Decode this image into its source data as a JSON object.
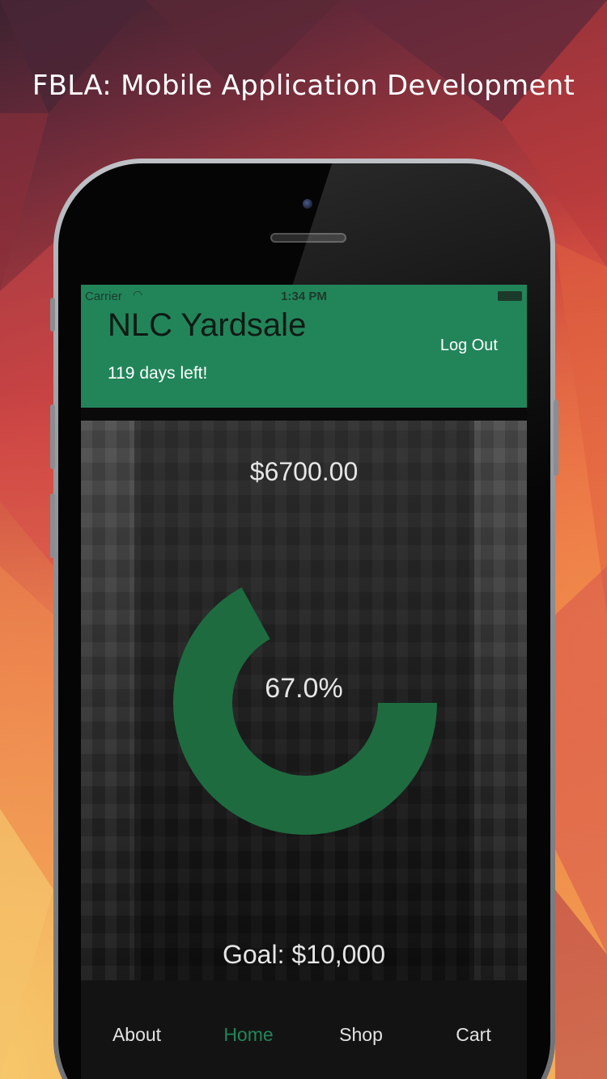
{
  "promo": {
    "title": "FBLA: Mobile Application Development"
  },
  "status_bar": {
    "carrier": "Carrier",
    "wifi_icon": "wifi-icon",
    "time": "1:34 PM",
    "battery_icon": "battery-icon"
  },
  "header": {
    "title": "NLC Yardsale",
    "days_left": "119 days left!",
    "logout_label": "Log Out"
  },
  "progress": {
    "raised": "$6700.00",
    "percent_label": "67.0%",
    "fraction": 0.67,
    "goal": "Goal: $10,000"
  },
  "tabs": [
    {
      "label": "About",
      "active": false
    },
    {
      "label": "Home",
      "active": true
    },
    {
      "label": "Shop",
      "active": false
    },
    {
      "label": "Cart",
      "active": false
    }
  ],
  "colors": {
    "accent": "#22855a",
    "donut": "#1e6b40"
  }
}
